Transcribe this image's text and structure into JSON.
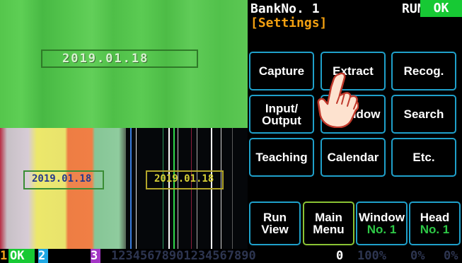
{
  "camera": {
    "main_overlay": "2019.01.18",
    "color_overlay": "2019.01.18",
    "dark_overlay": "2019.01.18"
  },
  "header": {
    "bank": "BankNo. 1",
    "run": "RUN",
    "ok": "OK",
    "section": "[Settings]"
  },
  "menu": {
    "capture": "Capture",
    "extract": "Extract",
    "recog": "Recog.",
    "io_line1": "Input/",
    "io_line2": "Output",
    "window": "Window",
    "search": "Search",
    "teaching": "Teaching",
    "calendar": "Calendar",
    "etc": "Etc."
  },
  "bottom": {
    "run_line1": "Run",
    "run_line2": "View",
    "main_line1": "Main",
    "main_line2": "Menu",
    "window_line1": "Window",
    "window_line2": "No. 1",
    "head_line1": "Head",
    "head_line2": "No. 1"
  },
  "status": {
    "n1": "1",
    "ok": "OK",
    "n2": "2",
    "n3": "3",
    "digits": "12345678901234567890",
    "zero": "0",
    "pct100": "100%",
    "pct0a": "0%",
    "pct0b": "0%"
  },
  "colors": {
    "accent_blue": "#1fa0ca",
    "ok_green": "#17c934",
    "settings_orange": "#f2a011",
    "main_menu_border": "#8ac334"
  },
  "icons": [
    "pointing-hand-icon"
  ]
}
